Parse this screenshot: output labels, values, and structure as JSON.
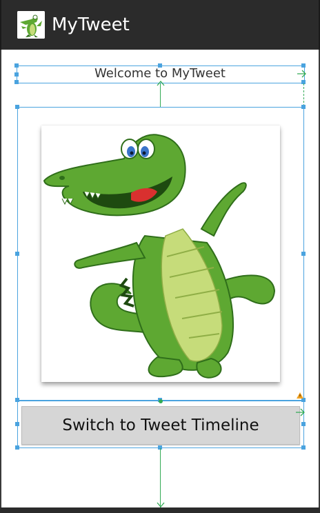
{
  "app": {
    "title": "MyTweet",
    "icon": "crocodile-app-icon"
  },
  "main": {
    "welcome_text": "Welcome to MyTweet",
    "image": "dancing-crocodile-image",
    "switch_button_label": "Switch to Tweet Timeline"
  },
  "colors": {
    "action_bar": "#2b2b2b",
    "selection_outline": "#4aa3df",
    "constraint_line": "#33aa55",
    "button_bg": "#d6d6d6",
    "crocodile_green": "#5ea832",
    "crocodile_belly": "#c6dc7a"
  }
}
